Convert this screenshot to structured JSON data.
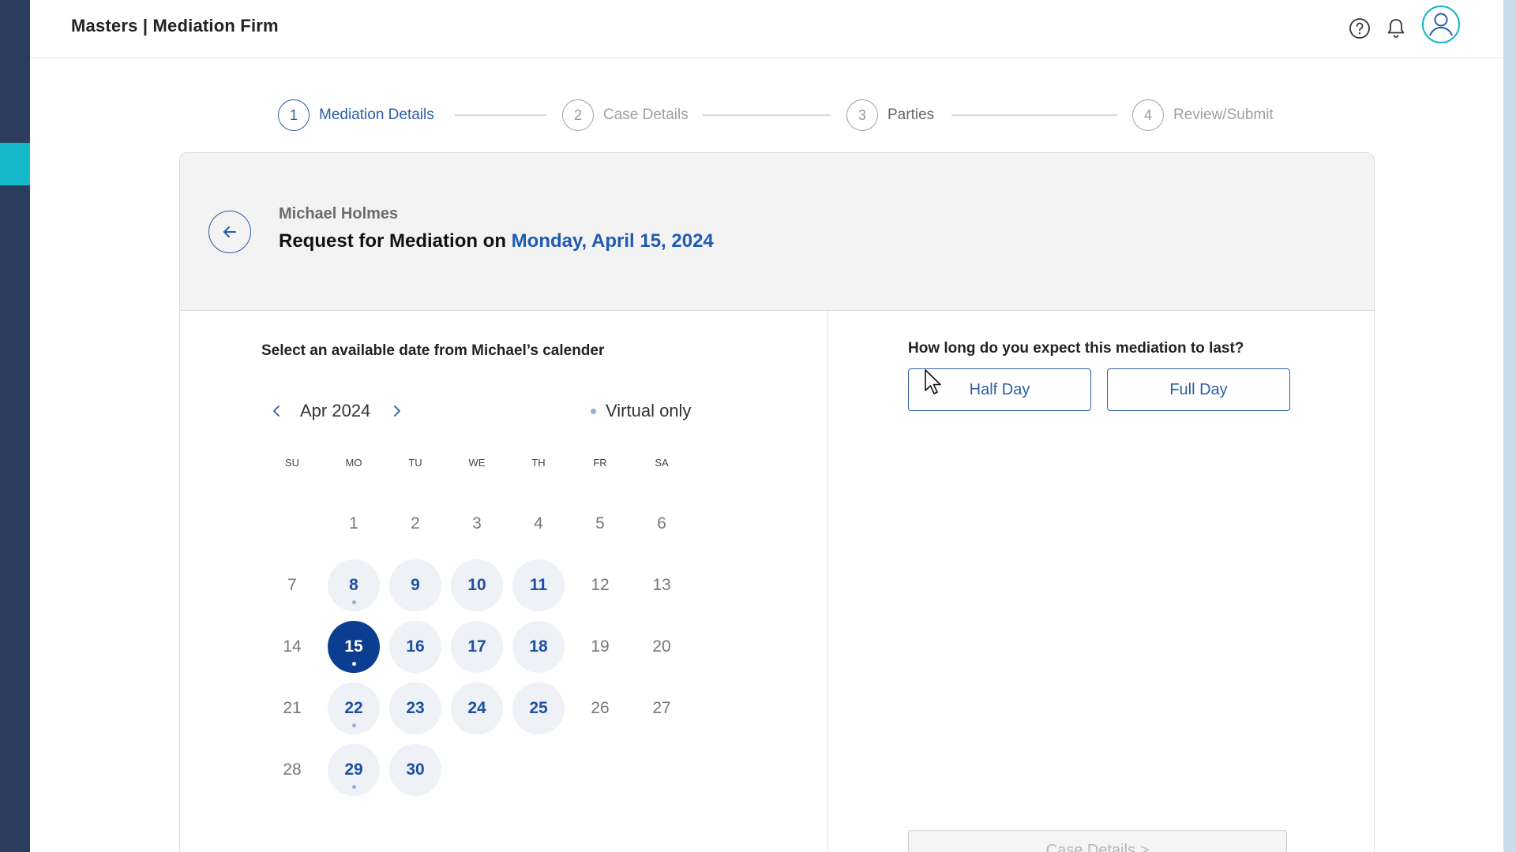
{
  "app": {
    "brand": "Masters | Mediation Firm"
  },
  "icons": {
    "help": "help-circle-icon",
    "bell": "bell-icon",
    "avatar": "user-avatar-icon",
    "back": "arrow-left-icon"
  },
  "colors": {
    "primary": "#2a5ea8",
    "selected_day": "#0b3d91",
    "sidebar": "#2b3c5c",
    "sidebar_accent": "#14b8c8"
  },
  "stepper": {
    "steps": [
      {
        "number": "1",
        "label": "Mediation Details",
        "state": "active"
      },
      {
        "number": "2",
        "label": "Case Details",
        "state": "inactive"
      },
      {
        "number": "3",
        "label": "Parties",
        "state": "inactive"
      },
      {
        "number": "4",
        "label": "Review/Submit",
        "state": "inactive"
      }
    ]
  },
  "header": {
    "name": "Michael Holmes",
    "request_prefix": "Request for Mediation on",
    "request_date": "Monday, April 15, 2024"
  },
  "calendar": {
    "title": "Select an available date from Michael’s calender",
    "month": "Apr 2024",
    "legend": "Virtual only",
    "weekdays": [
      "SU",
      "MO",
      "TU",
      "WE",
      "TH",
      "FR",
      "SA"
    ],
    "weeks": [
      [
        {
          "day": ""
        },
        {
          "day": "1"
        },
        {
          "day": "2"
        },
        {
          "day": "3"
        },
        {
          "day": "4"
        },
        {
          "day": "5"
        },
        {
          "day": "6"
        }
      ],
      [
        {
          "day": "7"
        },
        {
          "day": "8",
          "available": true,
          "virtual": true
        },
        {
          "day": "9",
          "available": true
        },
        {
          "day": "10",
          "available": true
        },
        {
          "day": "11",
          "available": true
        },
        {
          "day": "12"
        },
        {
          "day": "13"
        }
      ],
      [
        {
          "day": "14"
        },
        {
          "day": "15",
          "available": true,
          "virtual": true,
          "selected": true
        },
        {
          "day": "16",
          "available": true
        },
        {
          "day": "17",
          "available": true
        },
        {
          "day": "18",
          "available": true
        },
        {
          "day": "19"
        },
        {
          "day": "20"
        }
      ],
      [
        {
          "day": "21"
        },
        {
          "day": "22",
          "available": true,
          "virtual": true
        },
        {
          "day": "23",
          "available": true
        },
        {
          "day": "24",
          "available": true
        },
        {
          "day": "25",
          "available": true
        },
        {
          "day": "26"
        },
        {
          "day": "27"
        }
      ],
      [
        {
          "day": "28"
        },
        {
          "day": "29",
          "available": true,
          "virtual": true
        },
        {
          "day": "30",
          "available": true
        }
      ]
    ]
  },
  "duration": {
    "question": "How long do you expect this mediation to last?",
    "half_day": "Half Day",
    "full_day": "Full Day"
  },
  "footer": {
    "next_label": "Case Details >"
  }
}
